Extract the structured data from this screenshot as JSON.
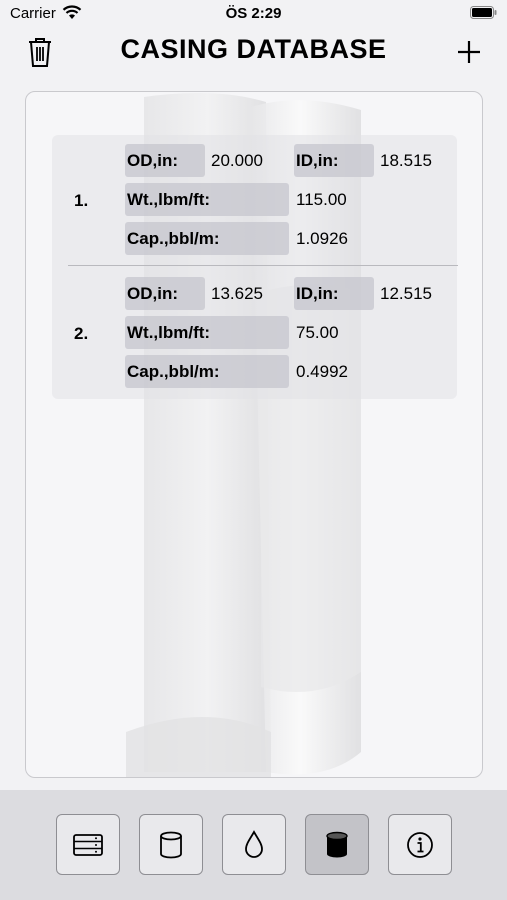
{
  "status_bar": {
    "carrier": "Carrier",
    "time": "ÖS 2:29",
    "icons": [
      "wifi-icon",
      "battery-icon"
    ]
  },
  "nav": {
    "title": "CASING DATABASE",
    "left_icon": "trash-icon",
    "right_icon": "plus-icon"
  },
  "casings": [
    {
      "number": "1.",
      "od_label": "OD,in:",
      "od": "20.000",
      "id_label": "ID,in:",
      "id": "18.515",
      "wt_label": "Wt.,lbm/ft:",
      "wt": "115.00",
      "cap_label": "Cap.,bbl/m:",
      "cap": "1.0926"
    },
    {
      "number": "2.",
      "od_label": "OD,in:",
      "od": "13.625",
      "id_label": "ID,in:",
      "id": "12.515",
      "wt_label": "Wt.,lbm/ft:",
      "wt": "75.00",
      "cap_label": "Cap.,bbl/m:",
      "cap": "0.4992"
    }
  ],
  "tab_bar": {
    "tabs": [
      {
        "icon": "database-list-icon",
        "selected": false
      },
      {
        "icon": "cylinder-outline-icon",
        "selected": false
      },
      {
        "icon": "drop-icon",
        "selected": false
      },
      {
        "icon": "cylinder-filled-icon",
        "selected": true
      },
      {
        "icon": "info-icon",
        "selected": false
      }
    ]
  },
  "colors": {
    "background": "#f2f2f4",
    "label_bg": "#c6c6cd",
    "tab_bar_bg": "#dcdce0",
    "tab_selected_bg": "#c3c3c8"
  }
}
